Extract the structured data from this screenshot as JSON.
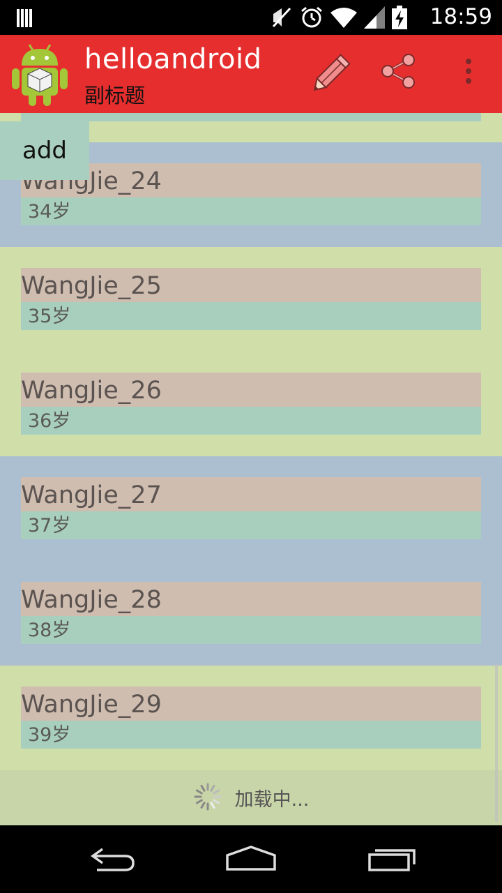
{
  "status_bar": {
    "time": "18:59",
    "icons": [
      "notification-icon",
      "mute-icon",
      "alarm-icon",
      "wifi-icon",
      "signal-icon",
      "battery-charging-icon"
    ]
  },
  "action_bar": {
    "title": "helloandroid",
    "subtitle": "副标题",
    "actions": [
      "edit-icon",
      "share-icon",
      "overflow-menu-icon"
    ],
    "color": "#e62e2e"
  },
  "list": {
    "add_label": "add",
    "items": [
      {
        "name": "WangJie_24",
        "age": "34岁"
      },
      {
        "name": "WangJie_25",
        "age": "35岁"
      },
      {
        "name": "WangJie_26",
        "age": "36岁"
      },
      {
        "name": "WangJie_27",
        "age": "37岁"
      },
      {
        "name": "WangJie_28",
        "age": "38岁"
      },
      {
        "name": "WangJie_29",
        "age": "39岁"
      }
    ],
    "loading_text": "加载中..."
  },
  "colors": {
    "group_green": "#d0dfaa",
    "group_blue": "#abbfd0",
    "name_bg": "#cfbdb0",
    "age_bg": "#a8cfbe"
  },
  "nav_bar": {
    "buttons": [
      "back-icon",
      "home-icon",
      "recents-icon"
    ]
  }
}
